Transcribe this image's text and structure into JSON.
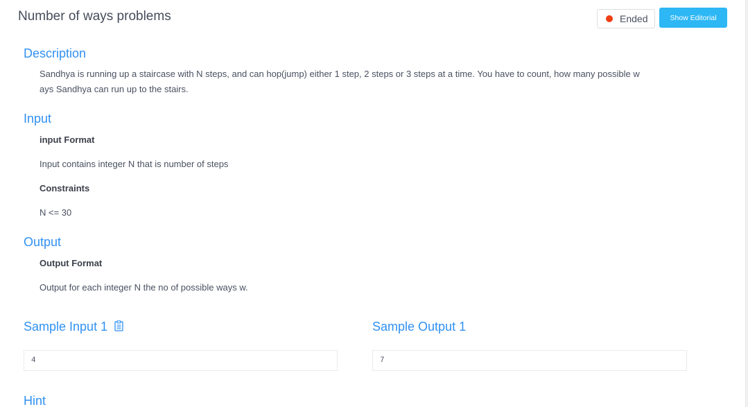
{
  "problem": {
    "title": "Number of ways problems",
    "status": "Ended",
    "show_editorial_label": "Show Editorial"
  },
  "description": {
    "heading": "Description",
    "line1": "Sandhya is running up a staircase with N steps, and can hop(jump) either 1 step, 2 steps or 3 steps at a time. You have to count, how many possible w",
    "line2": "ays Sandhya can run up to the stairs."
  },
  "input": {
    "heading": "Input",
    "format_label": "input Format",
    "format_text": "Input contains integer N that is number of steps",
    "constraints_label": "Constraints",
    "constraints_text": "N <= 30"
  },
  "output": {
    "heading": "Output",
    "format_label": "Output Format",
    "format_text": "Output for each integer N the no of possible ways w."
  },
  "samples": {
    "input_heading": "Sample Input 1",
    "input_value": "4",
    "output_heading": "Sample Output 1",
    "output_value": "7"
  },
  "hint": {
    "heading": "Hint"
  },
  "colors": {
    "accent": "#3091f2",
    "status_dot": "#ed3f14",
    "button": "#2db7f5"
  },
  "icons": {
    "copy": "clipboard-icon"
  }
}
